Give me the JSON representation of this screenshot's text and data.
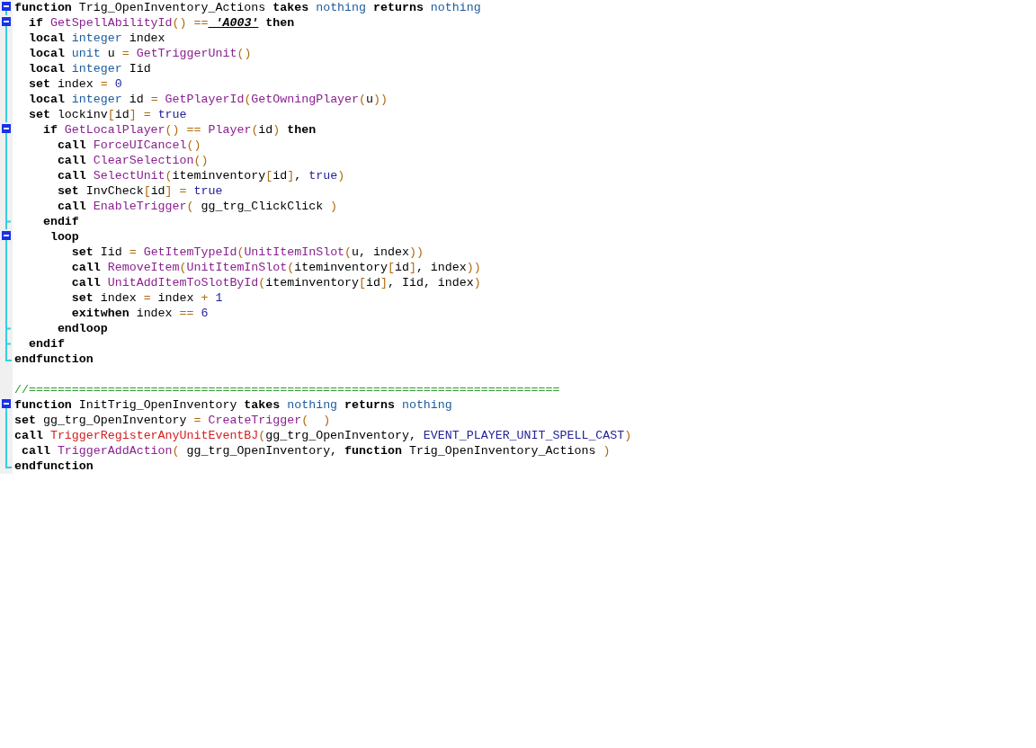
{
  "editor": {
    "lines": [
      {
        "kind": "fold-start",
        "tokens": [
          {
            "text": "function",
            "kind": "keyword"
          },
          {
            "text": " Trig_OpenInventory_Actions ",
            "kind": "plain"
          },
          {
            "text": "takes",
            "kind": "keyword"
          },
          {
            "text": " nothing",
            "kind": "type"
          },
          {
            "text": " returns",
            "kind": "keyword"
          },
          {
            "text": " nothing",
            "kind": "type"
          }
        ]
      },
      {
        "kind": "fold-start",
        "tokens": [
          {
            "text": "  if",
            "kind": "keyword"
          },
          {
            "text": " GetSpellAbilityId",
            "kind": "function"
          },
          {
            "text": "()",
            "kind": "operator"
          },
          {
            "text": " ==",
            "kind": "operator"
          },
          {
            "text": " 'A003'",
            "kind": "string"
          },
          {
            "text": " then",
            "kind": "keyword"
          }
        ]
      },
      {
        "kind": "fold-line",
        "tokens": [
          {
            "text": "  local",
            "kind": "keyword"
          },
          {
            "text": " integer",
            "kind": "type"
          },
          {
            "text": " index",
            "kind": "plain"
          }
        ]
      },
      {
        "kind": "fold-line",
        "tokens": [
          {
            "text": "  local",
            "kind": "keyword"
          },
          {
            "text": " unit",
            "kind": "type"
          },
          {
            "text": " u ",
            "kind": "plain"
          },
          {
            "text": "=",
            "kind": "operator"
          },
          {
            "text": " GetTriggerUnit",
            "kind": "function"
          },
          {
            "text": "()",
            "kind": "operator"
          }
        ]
      },
      {
        "kind": "fold-line",
        "tokens": [
          {
            "text": "  local",
            "kind": "keyword"
          },
          {
            "text": " integer",
            "kind": "type"
          },
          {
            "text": " Iid",
            "kind": "plain"
          }
        ]
      },
      {
        "kind": "fold-line",
        "tokens": [
          {
            "text": "  set",
            "kind": "keyword"
          },
          {
            "text": " index ",
            "kind": "plain"
          },
          {
            "text": "=",
            "kind": "operator"
          },
          {
            "text": " 0",
            "kind": "constant"
          }
        ]
      },
      {
        "kind": "fold-line",
        "tokens": [
          {
            "text": "  local",
            "kind": "keyword"
          },
          {
            "text": " integer",
            "kind": "type"
          },
          {
            "text": " id ",
            "kind": "plain"
          },
          {
            "text": "=",
            "kind": "operator"
          },
          {
            "text": " GetPlayerId",
            "kind": "function"
          },
          {
            "text": "(",
            "kind": "operator"
          },
          {
            "text": "GetOwningPlayer",
            "kind": "function"
          },
          {
            "text": "(",
            "kind": "operator"
          },
          {
            "text": "u",
            "kind": "plain"
          },
          {
            "text": "))",
            "kind": "operator"
          }
        ]
      },
      {
        "kind": "fold-line",
        "tokens": [
          {
            "text": "  set",
            "kind": "keyword"
          },
          {
            "text": " lockinv",
            "kind": "plain"
          },
          {
            "text": "[",
            "kind": "operator"
          },
          {
            "text": "id",
            "kind": "plain"
          },
          {
            "text": "]",
            "kind": "operator"
          },
          {
            "text": " =",
            "kind": "operator"
          },
          {
            "text": " true",
            "kind": "constant"
          }
        ]
      },
      {
        "kind": "fold-start",
        "tokens": [
          {
            "text": "    if",
            "kind": "keyword"
          },
          {
            "text": " GetLocalPlayer",
            "kind": "function"
          },
          {
            "text": "()",
            "kind": "operator"
          },
          {
            "text": " ==",
            "kind": "operator"
          },
          {
            "text": " Player",
            "kind": "function"
          },
          {
            "text": "(",
            "kind": "operator"
          },
          {
            "text": "id",
            "kind": "plain"
          },
          {
            "text": ")",
            "kind": "operator"
          },
          {
            "text": " then",
            "kind": "keyword"
          }
        ]
      },
      {
        "kind": "fold-line",
        "tokens": [
          {
            "text": "      call",
            "kind": "keyword"
          },
          {
            "text": " ForceUICancel",
            "kind": "function"
          },
          {
            "text": "()",
            "kind": "operator"
          }
        ]
      },
      {
        "kind": "fold-line",
        "tokens": [
          {
            "text": "      call",
            "kind": "keyword"
          },
          {
            "text": " ClearSelection",
            "kind": "function"
          },
          {
            "text": "()",
            "kind": "operator"
          }
        ]
      },
      {
        "kind": "fold-line",
        "tokens": [
          {
            "text": "      call",
            "kind": "keyword"
          },
          {
            "text": " SelectUnit",
            "kind": "function"
          },
          {
            "text": "(",
            "kind": "operator"
          },
          {
            "text": "iteminventory",
            "kind": "plain"
          },
          {
            "text": "[",
            "kind": "operator"
          },
          {
            "text": "id",
            "kind": "plain"
          },
          {
            "text": "]",
            "kind": "operator"
          },
          {
            "text": ",",
            "kind": "plain"
          },
          {
            "text": " true",
            "kind": "constant"
          },
          {
            "text": ")",
            "kind": "operator"
          }
        ]
      },
      {
        "kind": "fold-line",
        "tokens": [
          {
            "text": "      set",
            "kind": "keyword"
          },
          {
            "text": " InvCheck",
            "kind": "plain"
          },
          {
            "text": "[",
            "kind": "operator"
          },
          {
            "text": "id",
            "kind": "plain"
          },
          {
            "text": "]",
            "kind": "operator"
          },
          {
            "text": " =",
            "kind": "operator"
          },
          {
            "text": " true",
            "kind": "constant"
          }
        ]
      },
      {
        "kind": "fold-line",
        "tokens": [
          {
            "text": "      call",
            "kind": "keyword"
          },
          {
            "text": " EnableTrigger",
            "kind": "function"
          },
          {
            "text": "(",
            "kind": "operator"
          },
          {
            "text": " gg_trg_ClickClick ",
            "kind": "plain"
          },
          {
            "text": ")",
            "kind": "operator"
          }
        ]
      },
      {
        "kind": "fold-tick",
        "tokens": [
          {
            "text": "    endif",
            "kind": "keyword"
          }
        ]
      },
      {
        "kind": "fold-start",
        "tokens": [
          {
            "text": "     loop",
            "kind": "keyword"
          }
        ]
      },
      {
        "kind": "fold-line",
        "tokens": [
          {
            "text": "        set",
            "kind": "keyword"
          },
          {
            "text": " Iid ",
            "kind": "plain"
          },
          {
            "text": "=",
            "kind": "operator"
          },
          {
            "text": " GetItemTypeId",
            "kind": "function"
          },
          {
            "text": "(",
            "kind": "operator"
          },
          {
            "text": "UnitItemInSlot",
            "kind": "function"
          },
          {
            "text": "(",
            "kind": "operator"
          },
          {
            "text": "u, index",
            "kind": "plain"
          },
          {
            "text": "))",
            "kind": "operator"
          }
        ]
      },
      {
        "kind": "fold-line",
        "tokens": [
          {
            "text": "        call",
            "kind": "keyword"
          },
          {
            "text": " RemoveItem",
            "kind": "function"
          },
          {
            "text": "(",
            "kind": "operator"
          },
          {
            "text": "UnitItemInSlot",
            "kind": "function"
          },
          {
            "text": "(",
            "kind": "operator"
          },
          {
            "text": "iteminventory",
            "kind": "plain"
          },
          {
            "text": "[",
            "kind": "operator"
          },
          {
            "text": "id",
            "kind": "plain"
          },
          {
            "text": "]",
            "kind": "operator"
          },
          {
            "text": ", index",
            "kind": "plain"
          },
          {
            "text": "))",
            "kind": "operator"
          }
        ]
      },
      {
        "kind": "fold-line",
        "tokens": [
          {
            "text": "        call",
            "kind": "keyword"
          },
          {
            "text": " UnitAddItemToSlotById",
            "kind": "function"
          },
          {
            "text": "(",
            "kind": "operator"
          },
          {
            "text": "iteminventory",
            "kind": "plain"
          },
          {
            "text": "[",
            "kind": "operator"
          },
          {
            "text": "id",
            "kind": "plain"
          },
          {
            "text": "]",
            "kind": "operator"
          },
          {
            "text": ", Iid, index",
            "kind": "plain"
          },
          {
            "text": ")",
            "kind": "operator"
          }
        ]
      },
      {
        "kind": "fold-line",
        "tokens": [
          {
            "text": "        set",
            "kind": "keyword"
          },
          {
            "text": " index ",
            "kind": "plain"
          },
          {
            "text": "=",
            "kind": "operator"
          },
          {
            "text": " index ",
            "kind": "plain"
          },
          {
            "text": "+",
            "kind": "operator"
          },
          {
            "text": " 1",
            "kind": "constant"
          }
        ]
      },
      {
        "kind": "fold-line",
        "tokens": [
          {
            "text": "        exitwhen",
            "kind": "keyword"
          },
          {
            "text": " index ",
            "kind": "plain"
          },
          {
            "text": "==",
            "kind": "operator"
          },
          {
            "text": " 6",
            "kind": "constant"
          }
        ]
      },
      {
        "kind": "fold-tick",
        "tokens": [
          {
            "text": "      endloop",
            "kind": "keyword"
          }
        ]
      },
      {
        "kind": "fold-tick",
        "tokens": [
          {
            "text": "  endif",
            "kind": "keyword"
          }
        ]
      },
      {
        "kind": "fold-end",
        "tokens": [
          {
            "text": "endfunction",
            "kind": "keyword"
          }
        ]
      },
      {
        "kind": "blank"
      },
      {
        "kind": "plain",
        "tokens": [
          {
            "text": "//==========================================================================",
            "kind": "comment"
          }
        ]
      },
      {
        "kind": "fold-start",
        "tokens": [
          {
            "text": "function",
            "kind": "keyword"
          },
          {
            "text": " InitTrig_OpenInventory ",
            "kind": "plain"
          },
          {
            "text": "takes",
            "kind": "keyword"
          },
          {
            "text": " nothing",
            "kind": "type"
          },
          {
            "text": " returns",
            "kind": "keyword"
          },
          {
            "text": " nothing",
            "kind": "type"
          }
        ]
      },
      {
        "kind": "fold-line",
        "tokens": [
          {
            "text": "set",
            "kind": "keyword"
          },
          {
            "text": " gg_trg_OpenInventory ",
            "kind": "plain"
          },
          {
            "text": "=",
            "kind": "operator"
          },
          {
            "text": " CreateTrigger",
            "kind": "function"
          },
          {
            "text": "(  )",
            "kind": "operator"
          }
        ]
      },
      {
        "kind": "fold-line",
        "tokens": [
          {
            "text": "call",
            "kind": "keyword"
          },
          {
            "text": " TriggerRegisterAnyUnitEventBJ",
            "kind": "bj"
          },
          {
            "text": "(",
            "kind": "operator"
          },
          {
            "text": "gg_trg_OpenInventory,",
            "kind": "plain"
          },
          {
            "text": " EVENT_PLAYER_UNIT_SPELL_CAST",
            "kind": "constant"
          },
          {
            "text": ")",
            "kind": "operator"
          }
        ]
      },
      {
        "kind": "fold-line",
        "tokens": [
          {
            "text": " call",
            "kind": "keyword"
          },
          {
            "text": " TriggerAddAction",
            "kind": "function"
          },
          {
            "text": "(",
            "kind": "operator"
          },
          {
            "text": " gg_trg_OpenInventory,",
            "kind": "plain"
          },
          {
            "text": " function",
            "kind": "keyword"
          },
          {
            "text": " Trig_OpenInventory_Actions ",
            "kind": "plain"
          },
          {
            "text": ")",
            "kind": "operator"
          }
        ]
      },
      {
        "kind": "fold-end",
        "tokens": [
          {
            "text": "endfunction",
            "kind": "keyword"
          }
        ]
      }
    ]
  }
}
